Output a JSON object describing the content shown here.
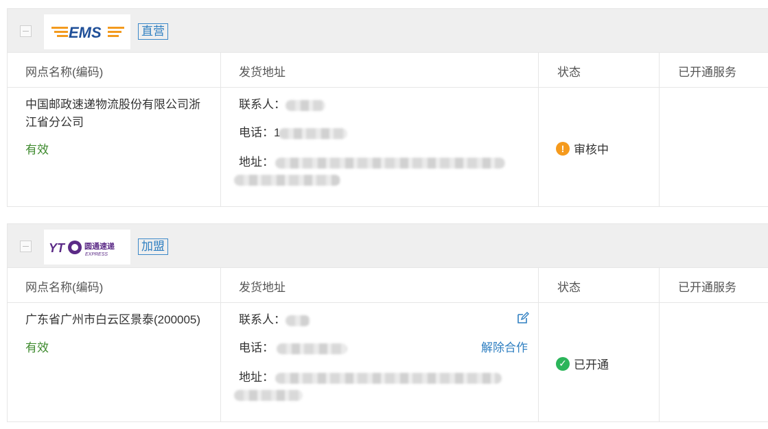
{
  "columns": {
    "name": "网点名称(编码)",
    "address": "发货地址",
    "status": "状态",
    "services": "已开通服务"
  },
  "cards": [
    {
      "logo_text": "EMS",
      "tag": "直营",
      "branch_name_line1": "中国邮政速递物流股份有限公司浙",
      "branch_name_line2": "江省分公司",
      "validity": "有效",
      "contact_label": "联系人：",
      "phone_label": "电话：",
      "phone_prefix": "1",
      "address_label": "地址：",
      "status_text": "审核中",
      "status_color": "#f59a1d",
      "status_icon": "exclamation-icon"
    },
    {
      "logo_text": "YTO",
      "logo_cn": "圆通速递",
      "logo_en": "EXPRESS",
      "tag": "加盟",
      "branch_name": "广东省广州市白云区景泰(200005)",
      "validity": "有效",
      "contact_label": "联系人：",
      "phone_label": "电话：",
      "address_label": "地址：",
      "unbind_label": "解除合作",
      "status_text": "已开通",
      "status_color": "#2bb55a",
      "status_icon": "check-icon"
    }
  ]
}
